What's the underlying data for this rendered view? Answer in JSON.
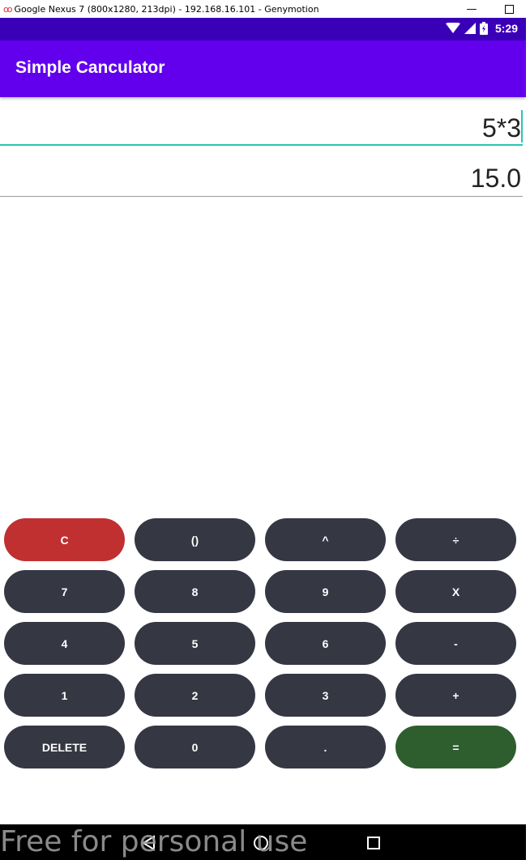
{
  "window": {
    "title": "Google Nexus 7 (800x1280, 213dpi) - 192.168.16.101 - Genymotion",
    "minimize_glyph": "—"
  },
  "status_bar": {
    "time": "5:29",
    "icons": [
      "wifi-icon",
      "signal-icon",
      "battery-icon"
    ]
  },
  "app_bar": {
    "title": "Simple Canculator"
  },
  "display": {
    "expression": "5*3",
    "result": "15.0"
  },
  "keypad": {
    "rows": [
      [
        "C",
        "()",
        "^",
        "÷"
      ],
      [
        "7",
        "8",
        "9",
        "X"
      ],
      [
        "4",
        "5",
        "6",
        "-"
      ],
      [
        "1",
        "2",
        "3",
        "+"
      ],
      [
        "DELETE",
        "0",
        ".",
        "="
      ]
    ],
    "colors": {
      "default": "#353743",
      "clear": "#c03030",
      "equals": "#2e5e2e"
    }
  },
  "nav_bar": {
    "buttons": [
      "back-icon",
      "home-icon",
      "recents-icon"
    ]
  },
  "watermark": {
    "text": "Free for personal use"
  },
  "theme": {
    "primary": "#6200ee",
    "status_bar": "#3a00b8",
    "accent": "#26c6b6"
  }
}
